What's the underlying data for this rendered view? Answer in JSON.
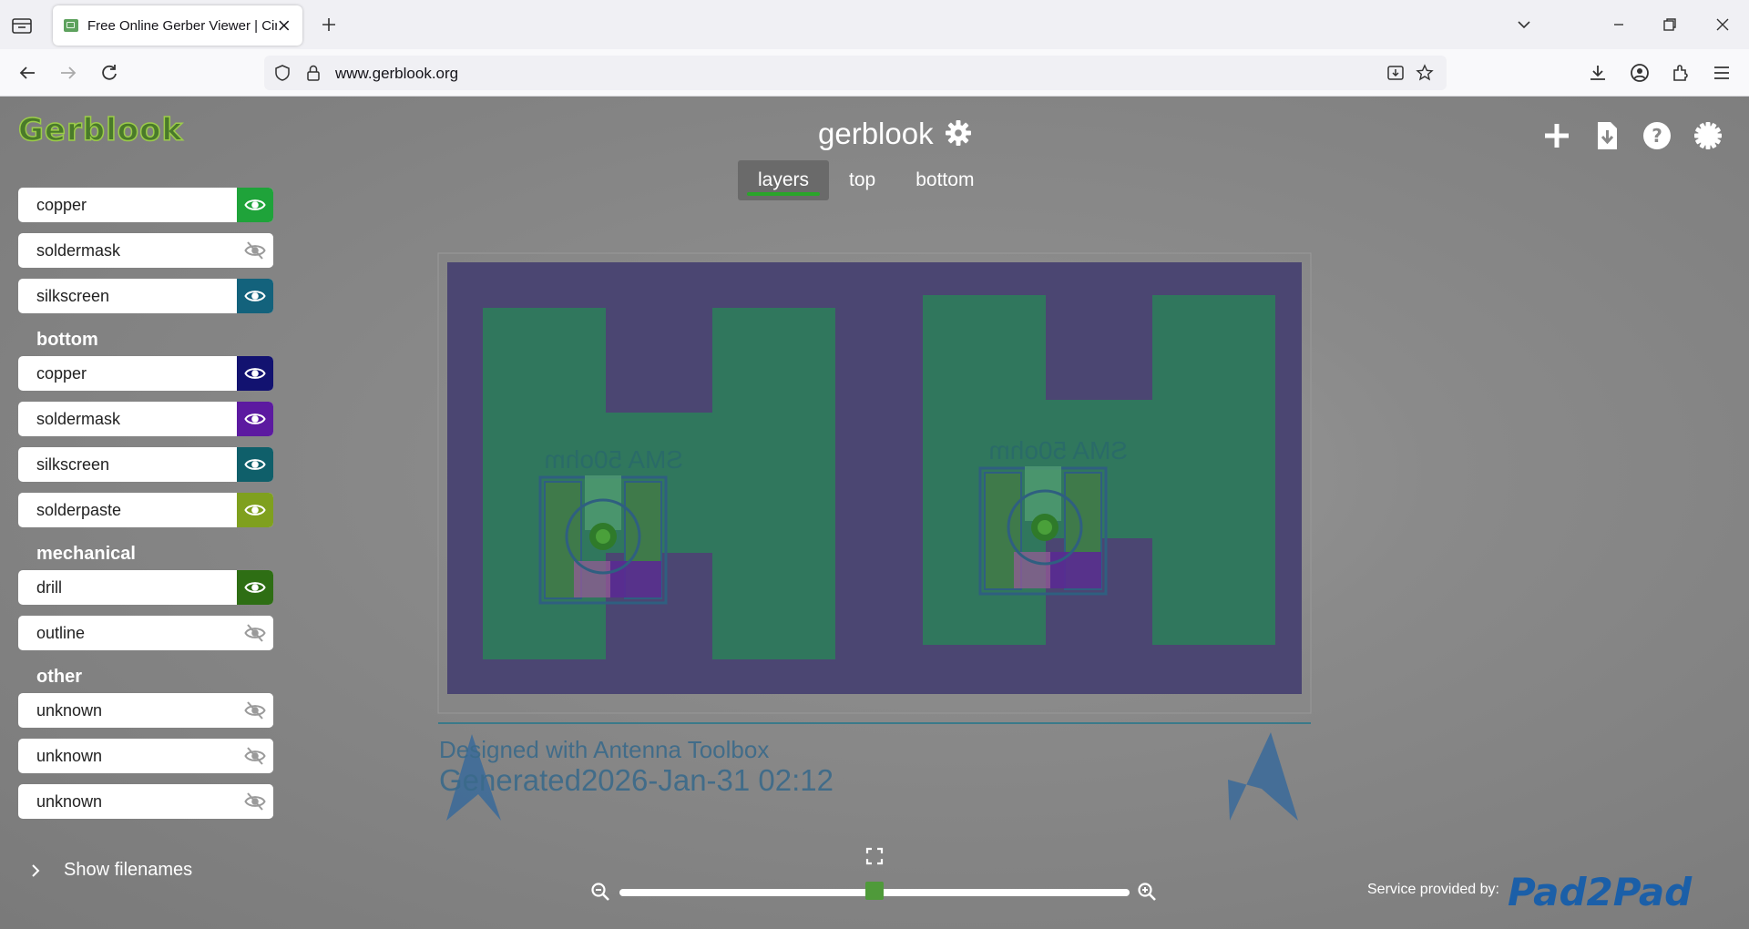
{
  "browser": {
    "tab_title": "Free Online Gerber Viewer | Circuit Board",
    "url": "www.gerblook.org"
  },
  "app": {
    "logo_text": "Gerblook",
    "title": "gerblook",
    "view_tabs": [
      {
        "label": "layers",
        "active": true
      },
      {
        "label": "top",
        "active": false
      },
      {
        "label": "bottom",
        "active": false
      }
    ]
  },
  "layers": {
    "top_items": [
      {
        "label": "copper",
        "visible": true,
        "color": "#1fa33a"
      },
      {
        "label": "soldermask",
        "visible": false,
        "color": "#ffffff"
      },
      {
        "label": "silkscreen",
        "visible": true,
        "color": "#13627c"
      }
    ],
    "bottom": {
      "heading": "bottom",
      "items": [
        {
          "label": "copper",
          "visible": true,
          "color": "#121270"
        },
        {
          "label": "soldermask",
          "visible": true,
          "color": "#5c1aa0"
        },
        {
          "label": "silkscreen",
          "visible": true,
          "color": "#0f5f6a"
        },
        {
          "label": "solderpaste",
          "visible": true,
          "color": "#7fa01e"
        }
      ]
    },
    "mechanical": {
      "heading": "mechanical",
      "items": [
        {
          "label": "drill",
          "visible": true,
          "color": "#2e6e14"
        },
        {
          "label": "outline",
          "visible": false,
          "color": "#ffffff"
        }
      ]
    },
    "other": {
      "heading": "other",
      "items": [
        {
          "label": "unknown",
          "visible": false,
          "color": "#ffffff"
        },
        {
          "label": "unknown",
          "visible": false,
          "color": "#ffffff"
        },
        {
          "label": "unknown",
          "visible": false,
          "color": "#ffffff"
        }
      ]
    }
  },
  "show_filenames_label": "Show filenames",
  "board": {
    "left_label": "SMA 50ohm",
    "right_label": "SMA 50ohm",
    "footer_line1": "Designed with Antenna Toolbox",
    "footer_line2": "Generated2026-Jan-31 02:12"
  },
  "zoom": {
    "level": 0.5
  },
  "footer": {
    "service_label": "Service provided by:",
    "sponsor": "Pad2Pad"
  },
  "colors": {
    "board_substrate": "#4b4672",
    "copper_pour": "#2e7a5c",
    "accent": "#2aa52a"
  }
}
